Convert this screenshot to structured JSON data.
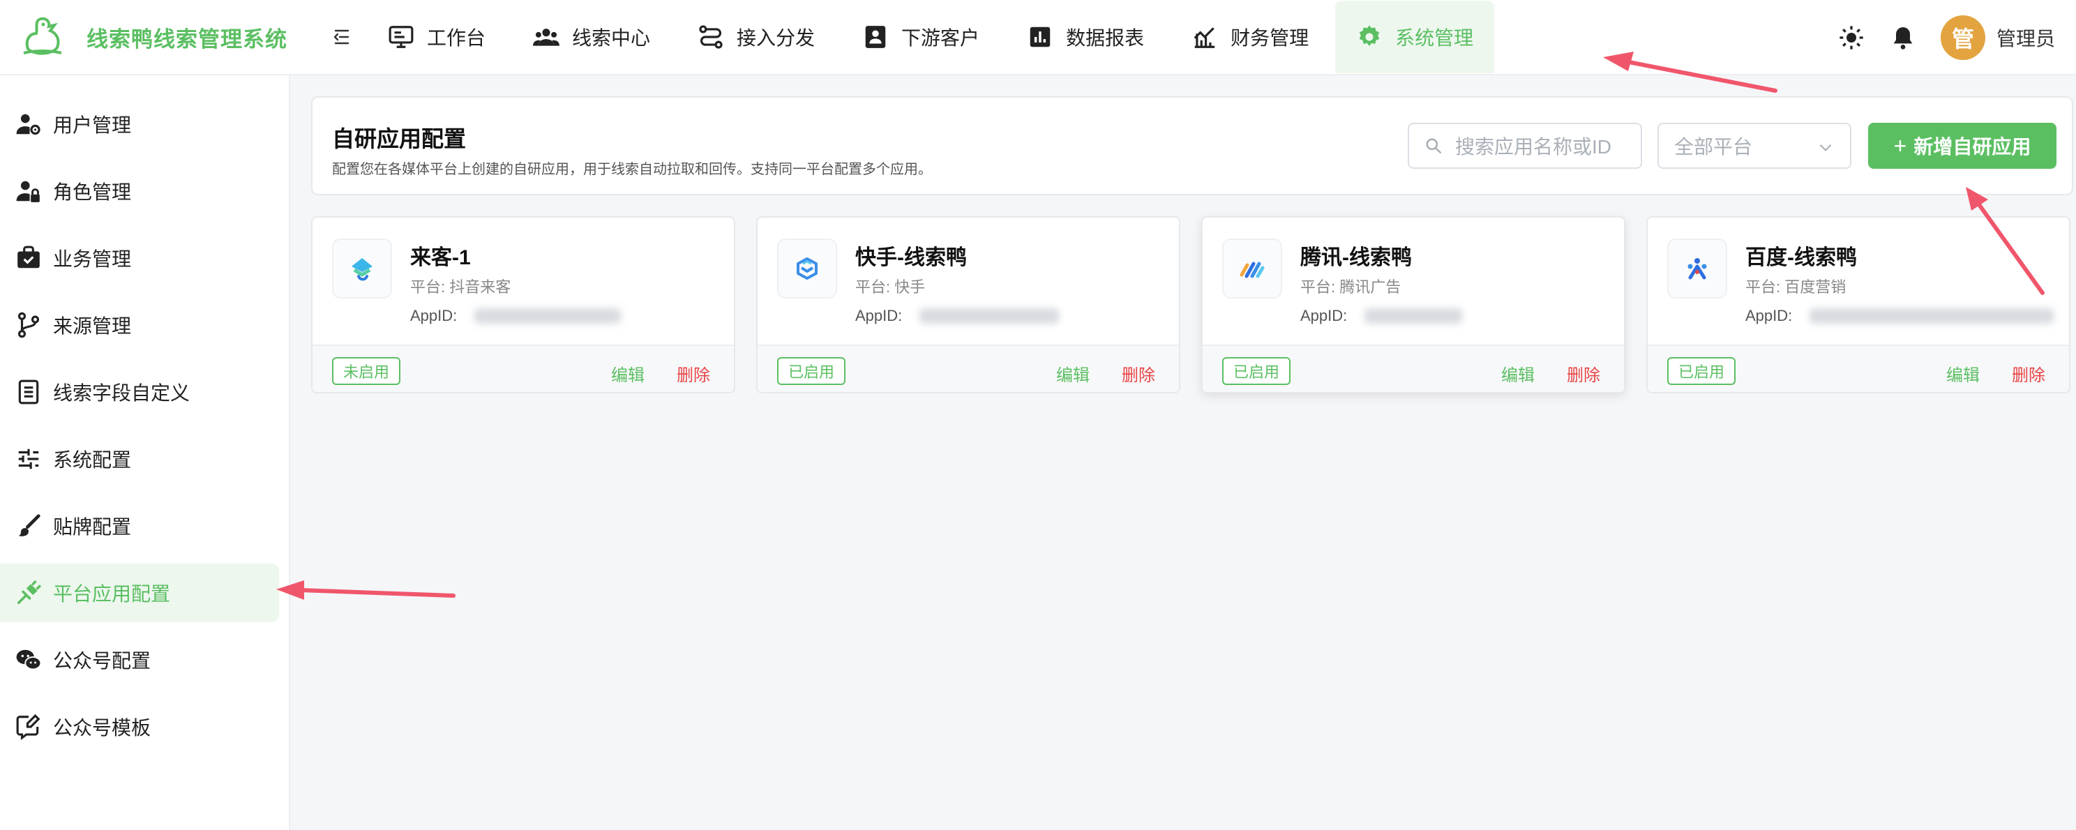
{
  "app": {
    "title": "线索鸭线索管理系统"
  },
  "nav": [
    {
      "label": "工作台",
      "icon": "monitor-icon"
    },
    {
      "label": "线索中心",
      "icon": "users-icon"
    },
    {
      "label": "接入分发",
      "icon": "route-icon"
    },
    {
      "label": "下游客户",
      "icon": "contact-card-icon"
    },
    {
      "label": "数据报表",
      "icon": "bar-chart-icon"
    },
    {
      "label": "财务管理",
      "icon": "finance-chart-icon"
    },
    {
      "label": "系统管理",
      "icon": "gear-icon",
      "active": true
    }
  ],
  "user": {
    "avatar_text": "管",
    "name": "管理员"
  },
  "sidebar": {
    "items": [
      {
        "label": "用户管理",
        "icon": "user-gear-icon"
      },
      {
        "label": "角色管理",
        "icon": "user-lock-icon"
      },
      {
        "label": "业务管理",
        "icon": "briefcase-icon"
      },
      {
        "label": "来源管理",
        "icon": "branch-icon"
      },
      {
        "label": "线索字段自定义",
        "icon": "document-icon"
      },
      {
        "label": "系统配置",
        "icon": "sliders-icon"
      },
      {
        "label": "贴牌配置",
        "icon": "brush-icon"
      },
      {
        "label": "平台应用配置",
        "icon": "plug-icon",
        "active": true
      },
      {
        "label": "公众号配置",
        "icon": "wechat-icon"
      },
      {
        "label": "公众号模板",
        "icon": "message-edit-icon"
      }
    ]
  },
  "header": {
    "title": "自研应用配置",
    "description": "配置您在各媒体平台上创建的自研应用，用于线索自动拉取和回传。支持同一平台配置多个应用。",
    "search_placeholder": "搜索应用名称或ID",
    "platform_select": "全部平台",
    "add_button": "新增自研应用",
    "add_icon": "+"
  },
  "cards": [
    {
      "name": "来客-1",
      "platform": "平台: 抖音来客",
      "appid_label": "AppID:",
      "status": "未启用",
      "edit": "编辑",
      "delete": "删除",
      "icon": "douyin-laike-logo-icon"
    },
    {
      "name": "快手-线索鸭",
      "platform": "平台: 快手",
      "appid_label": "AppID:",
      "status": "已启用",
      "edit": "编辑",
      "delete": "删除",
      "icon": "kuaishou-logo-icon"
    },
    {
      "name": "腾讯-线索鸭",
      "platform": "平台: 腾讯广告",
      "appid_label": "AppID:",
      "status": "已启用",
      "edit": "编辑",
      "delete": "删除",
      "icon": "tencent-ads-logo-icon"
    },
    {
      "name": "百度-线索鸭",
      "platform": "平台: 百度营销",
      "appid_label": "AppID:",
      "status": "已启用",
      "edit": "编辑",
      "delete": "删除",
      "icon": "baidu-marketing-logo-icon"
    }
  ],
  "colors": {
    "accent": "#5bbf62",
    "danger": "#e84545",
    "arrow": "#f0566b"
  }
}
